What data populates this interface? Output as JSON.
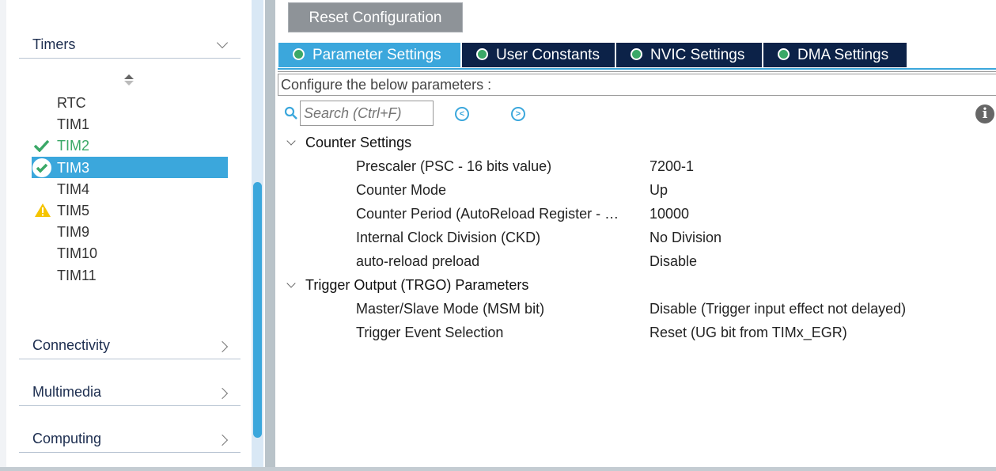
{
  "sidebar": {
    "categories": [
      {
        "label": "Timers",
        "expanded": true
      },
      {
        "label": "Connectivity"
      },
      {
        "label": "Multimedia"
      },
      {
        "label": "Computing"
      }
    ],
    "items": [
      {
        "label": "RTC",
        "status": "none"
      },
      {
        "label": "TIM1",
        "status": "none"
      },
      {
        "label": "TIM2",
        "status": "ok"
      },
      {
        "label": "TIM3",
        "status": "ok",
        "selected": true
      },
      {
        "label": "TIM4",
        "status": "none"
      },
      {
        "label": "TIM5",
        "status": "warning"
      },
      {
        "label": "TIM9",
        "status": "none"
      },
      {
        "label": "TIM10",
        "status": "none"
      },
      {
        "label": "TIM11",
        "status": "none"
      }
    ]
  },
  "toolbar": {
    "reset_label": "Reset Configuration"
  },
  "tabs": [
    {
      "label": "Parameter Settings",
      "active": true
    },
    {
      "label": "User Constants"
    },
    {
      "label": "NVIC Settings"
    },
    {
      "label": "DMA Settings"
    }
  ],
  "main": {
    "configure_label": "Configure the below parameters :",
    "search_placeholder": "Search (Ctrl+F)",
    "groups": [
      {
        "title": "Counter Settings",
        "rows": [
          {
            "name": "Prescaler (PSC - 16 bits value)",
            "value": "7200-1"
          },
          {
            "name": "Counter Mode",
            "value": "Up"
          },
          {
            "name": "Counter Period (AutoReload Register - …",
            "value": "10000"
          },
          {
            "name": "Internal Clock Division (CKD)",
            "value": "No Division"
          },
          {
            "name": "auto-reload preload",
            "value": "Disable"
          }
        ]
      },
      {
        "title": "Trigger Output (TRGO) Parameters",
        "rows": [
          {
            "name": "Master/Slave Mode (MSM bit)",
            "value": "Disable (Trigger input effect not delayed)"
          },
          {
            "name": "Trigger Event Selection",
            "value": "Reset (UG bit from TIMx_EGR)"
          }
        ]
      }
    ]
  },
  "colors": {
    "accent": "#3ba7dc",
    "tab_dark": "#0c2248",
    "ok": "#3aa867",
    "warning": "#f5c400"
  }
}
